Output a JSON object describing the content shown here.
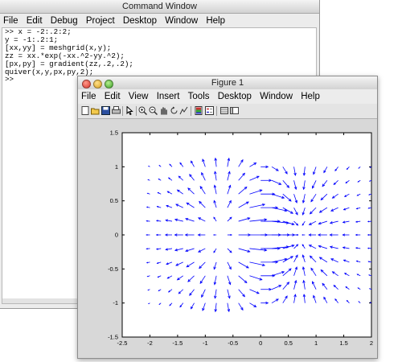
{
  "command_window": {
    "title": "Command Window",
    "menu": [
      "File",
      "Edit",
      "Debug",
      "Project",
      "Desktop",
      "Window",
      "Help"
    ],
    "lines": [
      ">> x = -2:.2:2;",
      "y = -1:.2:1;",
      "[xx,yy] = meshgrid(x,y);",
      "zz = xx.*exp(-xx.^2-yy.^2);",
      "[px,py] = gradient(zz,.2,.2);",
      "quiver(x,y,px,py,2);",
      ">>"
    ]
  },
  "figure_window": {
    "title": "Figure 1",
    "menu": [
      "File",
      "Edit",
      "View",
      "Insert",
      "Tools",
      "Desktop",
      "Window",
      "Help"
    ],
    "toolbar_icons": [
      "new-icon",
      "open-icon",
      "save-icon",
      "print-icon",
      "pointer-icon",
      "zoom-in-icon",
      "zoom-out-icon",
      "pan-icon",
      "rotate-icon",
      "data-cursor-icon",
      "colorbar-icon",
      "legend-icon",
      "hide-plot-tools-icon",
      "show-plot-tools-icon"
    ]
  },
  "chart_data": {
    "type": "quiver",
    "title": "",
    "xlabel": "",
    "ylabel": "",
    "xlim": [
      -2.5,
      2
    ],
    "ylim": [
      -1.5,
      1.5
    ],
    "xticks": [
      "-2.5",
      "-2",
      "-1.5",
      "-1",
      "-0.5",
      "0",
      "0.5",
      "1",
      "1.5",
      "2"
    ],
    "yticks": [
      "-1.5",
      "-1",
      "-0.5",
      "0",
      "0.5",
      "1",
      "1.5"
    ],
    "x": {
      "start": -2,
      "step": 0.2,
      "end": 2
    },
    "y": {
      "start": -1,
      "step": 0.2,
      "end": 1
    },
    "field": "gradient of x*exp(-x^2-y^2)",
    "scale": 2,
    "arrow_color": "#0000ff",
    "grid": false
  }
}
